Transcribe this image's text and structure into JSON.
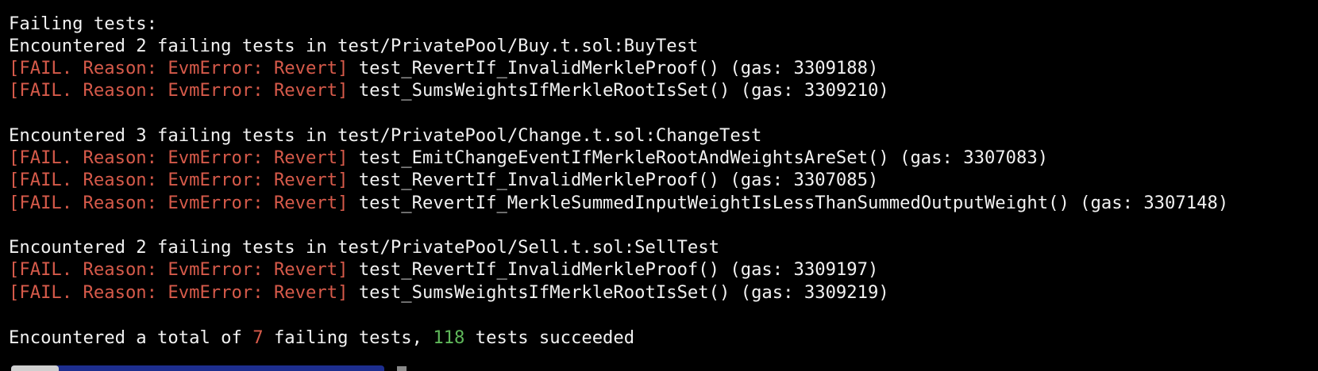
{
  "colors": {
    "background": "#000000",
    "text": "#f2f2f2",
    "fail": "#d65a4a",
    "success": "#5fb85a"
  },
  "output": {
    "header": "Failing tests:",
    "groups": [
      {
        "summary": "Encountered 2 failing tests in test/PrivatePool/Buy.t.sol:BuyTest",
        "tests": [
          {
            "reason": "[FAIL. Reason: EvmError: Revert]",
            "detail": " test_RevertIf_InvalidMerkleProof() (gas: 3309188)"
          },
          {
            "reason": "[FAIL. Reason: EvmError: Revert]",
            "detail": " test_SumsWeightsIfMerkleRootIsSet() (gas: 3309210)"
          }
        ]
      },
      {
        "summary": "Encountered 3 failing tests in test/PrivatePool/Change.t.sol:ChangeTest",
        "tests": [
          {
            "reason": "[FAIL. Reason: EvmError: Revert]",
            "detail": " test_EmitChangeEventIfMerkleRootAndWeightsAreSet() (gas: 3307083)"
          },
          {
            "reason": "[FAIL. Reason: EvmError: Revert]",
            "detail": " test_RevertIf_InvalidMerkleProof() (gas: 3307085)"
          },
          {
            "reason": "[FAIL. Reason: EvmError: Revert]",
            "detail": " test_RevertIf_MerkleSummedInputWeightIsLessThanSummedOutputWeight() (gas: 3307148)"
          }
        ]
      },
      {
        "summary": "Encountered 2 failing tests in test/PrivatePool/Sell.t.sol:SellTest",
        "tests": [
          {
            "reason": "[FAIL. Reason: EvmError: Revert]",
            "detail": " test_RevertIf_InvalidMerkleProof() (gas: 3309197)"
          },
          {
            "reason": "[FAIL. Reason: EvmError: Revert]",
            "detail": " test_SumsWeightsIfMerkleRootIsSet() (gas: 3309219)"
          }
        ]
      }
    ],
    "total": {
      "prefix": "Encountered a total of ",
      "failing_count": "7",
      "middle": " failing tests, ",
      "succeeded_count": "118",
      "suffix": " tests succeeded"
    }
  }
}
